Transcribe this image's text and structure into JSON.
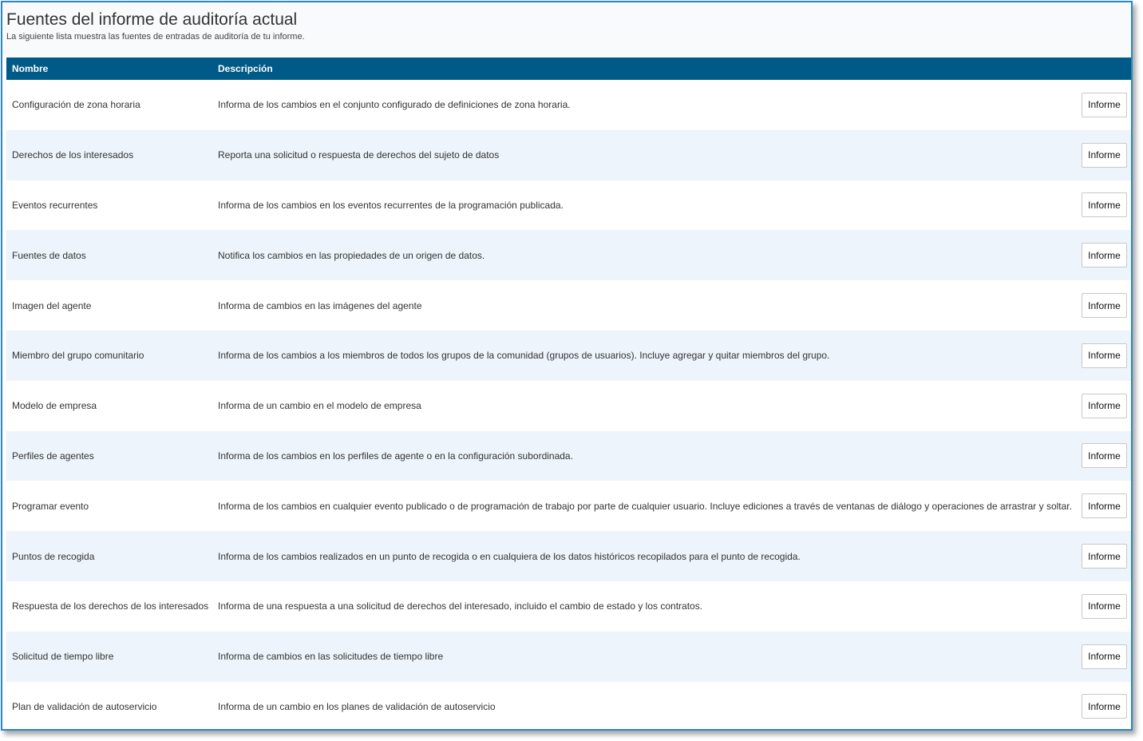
{
  "header": {
    "title": "Fuentes del informe de auditoría actual",
    "subtitle": "La siguiente lista muestra las fuentes de entradas de auditoría de tu informe."
  },
  "table": {
    "columns": [
      "Nombre",
      "Descripción"
    ],
    "button_label": "Informe",
    "rows": [
      {
        "name": "Configuración de zona horaria",
        "description": "Informa de los cambios en el conjunto configurado de definiciones de zona horaria."
      },
      {
        "name": "Derechos de los interesados",
        "description": "Reporta una solicitud o respuesta de derechos del sujeto de datos"
      },
      {
        "name": "Eventos recurrentes",
        "description": "Informa de los cambios en los eventos recurrentes de la programación publicada."
      },
      {
        "name": "Fuentes de datos",
        "description": "Notifica los cambios en las propiedades de un origen de datos."
      },
      {
        "name": "Imagen del agente",
        "description": "Informa de cambios en las imágenes del agente"
      },
      {
        "name": "Miembro del grupo comunitario",
        "description": "Informa de los cambios a los miembros de todos los grupos de la comunidad (grupos de usuarios). Incluye agregar y quitar miembros del grupo."
      },
      {
        "name": "Modelo de empresa",
        "description": "Informa de un cambio en el modelo de empresa"
      },
      {
        "name": "Perfiles de agentes",
        "description": "Informa de los cambios en los perfiles de agente o en la configuración subordinada."
      },
      {
        "name": "Programar evento",
        "description": "Informa de los cambios en cualquier evento publicado o de programación de trabajo por parte de cualquier usuario. Incluye ediciones a través de ventanas de diálogo y operaciones de arrastrar y soltar."
      },
      {
        "name": "Puntos de recogida",
        "description": "Informa de los cambios realizados en un punto de recogida o en cualquiera de los datos históricos recopilados para el punto de recogida."
      },
      {
        "name": "Respuesta de los derechos de los interesados",
        "description": "Informa de una respuesta a una solicitud de derechos del interesado, incluido el cambio de estado y los contratos."
      },
      {
        "name": "Solicitud de tiempo libre",
        "description": "Informa de cambios en las solicitudes de tiempo libre"
      },
      {
        "name": "Plan de validación de autoservicio",
        "description": "Informa de un cambio en los planes de validación de autoservicio"
      }
    ]
  }
}
